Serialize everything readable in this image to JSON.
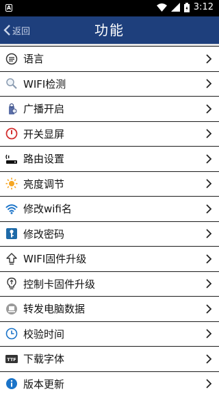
{
  "status_bar": {
    "time": "3:12"
  },
  "nav": {
    "back_label": "返回",
    "title": "功能"
  },
  "items": [
    {
      "label": "语言",
      "icon": "language-icon"
    },
    {
      "label": "WIFI检测",
      "icon": "search-icon"
    },
    {
      "label": "广播开启",
      "icon": "broadcast-icon"
    },
    {
      "label": "开关显屏",
      "icon": "power-icon"
    },
    {
      "label": "路由设置",
      "icon": "router-icon"
    },
    {
      "label": "亮度调节",
      "icon": "brightness-icon"
    },
    {
      "label": "修改wifi名",
      "icon": "wifi-icon"
    },
    {
      "label": "修改密码",
      "icon": "key-icon"
    },
    {
      "label": "WIFI固件升级",
      "icon": "upgrade-arrow-icon"
    },
    {
      "label": "控制卡固件升级",
      "icon": "lightbulb-icon"
    },
    {
      "label": "转发电脑数据",
      "icon": "computer-icon"
    },
    {
      "label": "校验时间",
      "icon": "clock-icon"
    },
    {
      "label": "下载字体",
      "icon": "ttf-font-icon"
    },
    {
      "label": "版本更新",
      "icon": "info-icon"
    }
  ],
  "colors": {
    "nav_bg": "#1e3f7c",
    "accent_blue": "#1a73c8",
    "power_red": "#d32f2f",
    "brightness_orange": "#f5a623"
  }
}
